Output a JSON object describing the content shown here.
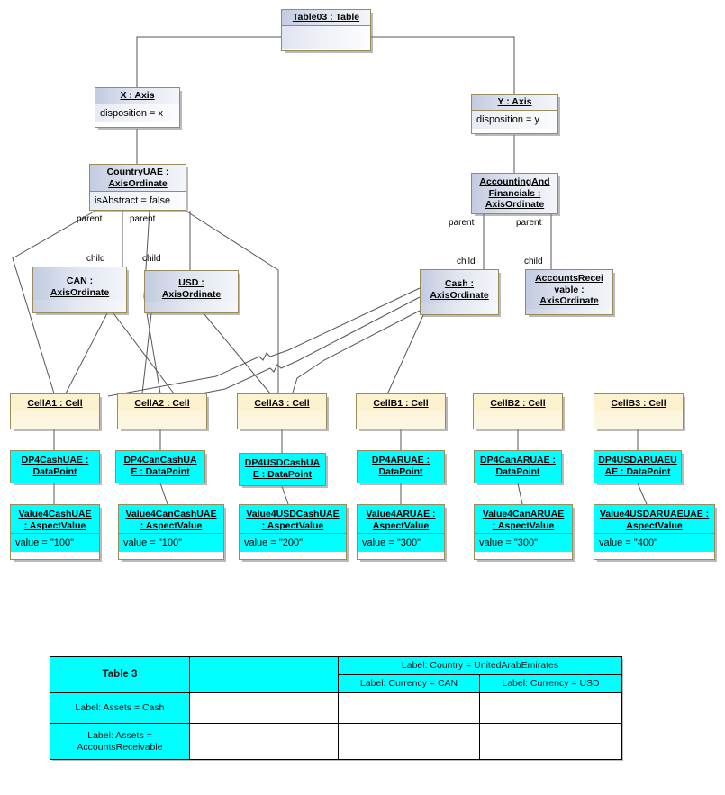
{
  "diagram": {
    "title": "Table03 object diagram",
    "colors": {
      "cyan": "#00ffff",
      "cell_yellow": "#fdf2cf",
      "axis_blue": "#c2cbe0",
      "border": "#9a8c5a",
      "edge": "#555555"
    }
  },
  "nodes": {
    "table03": {
      "name": "Table03 : Table",
      "attr": ""
    },
    "x_axis": {
      "name": "X : Axis",
      "attr": "disposition = x"
    },
    "y_axis": {
      "name": "Y : Axis",
      "attr": "disposition = y"
    },
    "country_uae": {
      "name": "CountryUAE :\nAxisOrdinate",
      "attr": "isAbstract = false"
    },
    "acc_fin": {
      "name": "AccountingAnd\nFinancials :\nAxisOrdinate",
      "attr": ""
    },
    "can": {
      "name": "CAN :\nAxisOrdinate",
      "attr": ""
    },
    "usd": {
      "name": "USD :\nAxisOrdinate",
      "attr": ""
    },
    "cash": {
      "name": "Cash :\nAxisOrdinate",
      "attr": ""
    },
    "accounts_recv": {
      "name": "AccountsRecei\nvable :\nAxisOrdinate",
      "attr": ""
    },
    "cellA1": {
      "name": "CellA1 : Cell",
      "attr": ""
    },
    "cellA2": {
      "name": "CellA2 : Cell",
      "attr": ""
    },
    "cellA3": {
      "name": "CellA3 : Cell",
      "attr": ""
    },
    "cellB1": {
      "name": "CellB1 : Cell",
      "attr": ""
    },
    "cellB2": {
      "name": "CellB2 : Cell",
      "attr": ""
    },
    "cellB3": {
      "name": "CellB3 : Cell",
      "attr": ""
    },
    "dpA1": {
      "name": "DP4CashUAE :\nDataPoint",
      "attr": ""
    },
    "dpA2": {
      "name": "DP4CanCashUA\nE : DataPoint",
      "attr": ""
    },
    "dpA3": {
      "name": "DP4USDCashUA\nE : DataPoint",
      "attr": ""
    },
    "dpB1": {
      "name": "DP4ARUAE :\nDataPoint",
      "attr": ""
    },
    "dpB2": {
      "name": "DP4CanARUAE :\nDataPoint",
      "attr": ""
    },
    "dpB3": {
      "name": "DP4USDARUAEU\nAE : DataPoint",
      "attr": ""
    },
    "avA1": {
      "name": "Value4CashUAE\n: AspectValue",
      "attr": "value = \"100\""
    },
    "avA2": {
      "name": "Value4CanCashUAE\n: AspectValue",
      "attr": "value = \"100\""
    },
    "avA3": {
      "name": "Value4USDCashUAE\n: AspectValue",
      "attr": "value = \"200\""
    },
    "avB1": {
      "name": "Value4ARUAE :\nAspectValue",
      "attr": "value = \"300\""
    },
    "avB2": {
      "name": "Value4CanARUAE\n: AspectValue",
      "attr": "value = \"300\""
    },
    "avB3": {
      "name": "Value4USDARUAEUAE :\nAspectValue",
      "attr": "value = \"400\""
    }
  },
  "edge_labels": {
    "parent_can": "parent",
    "parent_usd": "parent",
    "child_can": "child",
    "child_usd": "child",
    "parent_cash": "parent",
    "parent_ar": "parent",
    "child_cash": "child",
    "child_ar": "child"
  },
  "rendered_table": {
    "title": "Table 3",
    "country_header": "Label: Country = UnitedArabEmirates",
    "currency_headers": [
      "Label: Currency = CAN",
      "Label: Currency = USD"
    ],
    "row_headers": [
      "Label: Assets = Cash",
      "Label: Assets =\nAccountsReceivable"
    ],
    "cells": [
      [
        "",
        "",
        ""
      ],
      [
        "",
        "",
        ""
      ]
    ]
  }
}
